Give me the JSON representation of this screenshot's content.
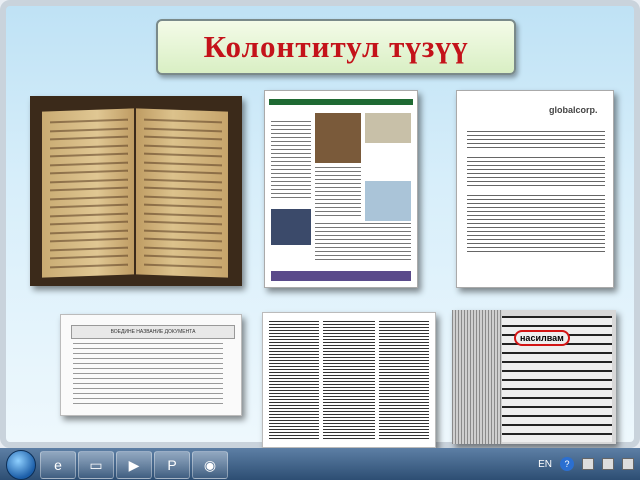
{
  "slide": {
    "title": "Колонтитул түзүү"
  },
  "images": {
    "letter_logo": "globalcorp.",
    "doc_header": "ВОЕДИНЕ НАЗВАНИЕ ДОКУМЕНТА",
    "dictionary_word": "насилвам"
  },
  "taskbar": {
    "language": "EN",
    "help": "?"
  },
  "colors": {
    "title_text": "#c4121a",
    "title_bg": "#e6f5d6",
    "taskbar": "#3b5f88"
  }
}
